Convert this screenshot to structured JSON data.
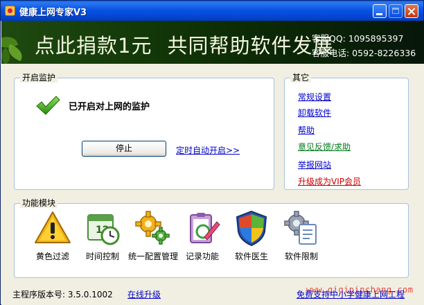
{
  "window": {
    "title": "健康上网专家V3"
  },
  "banner": {
    "slogan_1": "点此捐款1元",
    "slogan_2": "共同帮助软件发展",
    "qq": "客服QQ: 1095895397",
    "phone": "客服电话: 0592-8226336"
  },
  "monitor": {
    "legend": "开启监护",
    "status": "已开启对上网的监护",
    "stop_label": "停止",
    "schedule_link": "定时自动开启>>"
  },
  "other": {
    "legend": "其它",
    "links": [
      {
        "label": "常规设置",
        "color": "#0000cc"
      },
      {
        "label": "卸载软件",
        "color": "#0000cc"
      },
      {
        "label": "帮助",
        "color": "#0000cc"
      },
      {
        "label": "意见反馈/求助",
        "color": "#007a1a"
      },
      {
        "label": "举报网站",
        "color": "#0000cc"
      },
      {
        "label": "升级成为VIP会员",
        "color": "#cc0000"
      }
    ]
  },
  "modules": {
    "legend": "功能模块",
    "items": [
      {
        "label": "黄色过滤",
        "icon": "warning-icon"
      },
      {
        "label": "时间控制",
        "icon": "calendar-clock-icon"
      },
      {
        "label": "统一配置管理",
        "icon": "gears-icon"
      },
      {
        "label": "记录功能",
        "icon": "clipboard-pen-icon"
      },
      {
        "label": "软件医生",
        "icon": "shield-icon"
      },
      {
        "label": "软件限制",
        "icon": "gear-document-icon"
      }
    ]
  },
  "footer": {
    "version": "主程序版本号: 3.5.0.1002",
    "update_link": "在线升级",
    "free_link": "免费支持中小学健康上网工程",
    "watermark": "www.qiqipinchang.com"
  },
  "colors": {
    "titlebar": "#0854e3",
    "banner": "#143a09",
    "link": "#0000cc"
  }
}
